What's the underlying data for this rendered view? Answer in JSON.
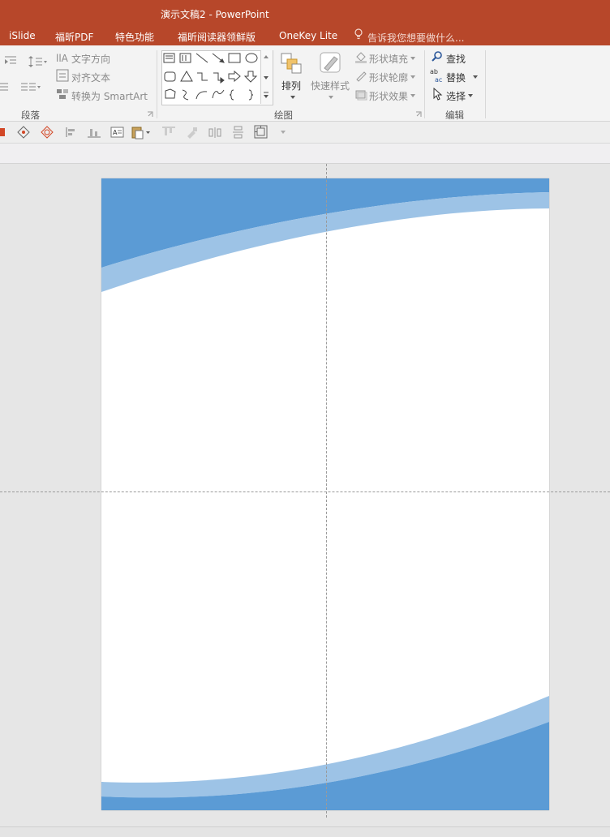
{
  "titlebar": {
    "title": "演示文稿2 - PowerPoint",
    "tabs": [
      "iSlide",
      "福昕PDF",
      "特色功能",
      "福昕阅读器领鲜版",
      "OneKey Lite"
    ],
    "tell_me": "告诉我您想要做什么...",
    "bg_color": "#b7472a"
  },
  "ribbon": {
    "paragraph": {
      "label": "段落",
      "text_direction": "文字方向",
      "align_text": "对齐文本",
      "convert_smartart": "转换为 SmartArt"
    },
    "drawing": {
      "label": "绘图",
      "arrange": "排列",
      "quick_styles": "快速样式",
      "shape_fill": "形状填充",
      "shape_outline": "形状轮廓",
      "shape_effects": "形状效果"
    },
    "editing": {
      "label": "编辑",
      "find": "查找",
      "replace": "替换",
      "select": "选择"
    }
  },
  "slide": {
    "wave_dark": "#5b9bd5",
    "wave_light": "#9dc3e6"
  }
}
